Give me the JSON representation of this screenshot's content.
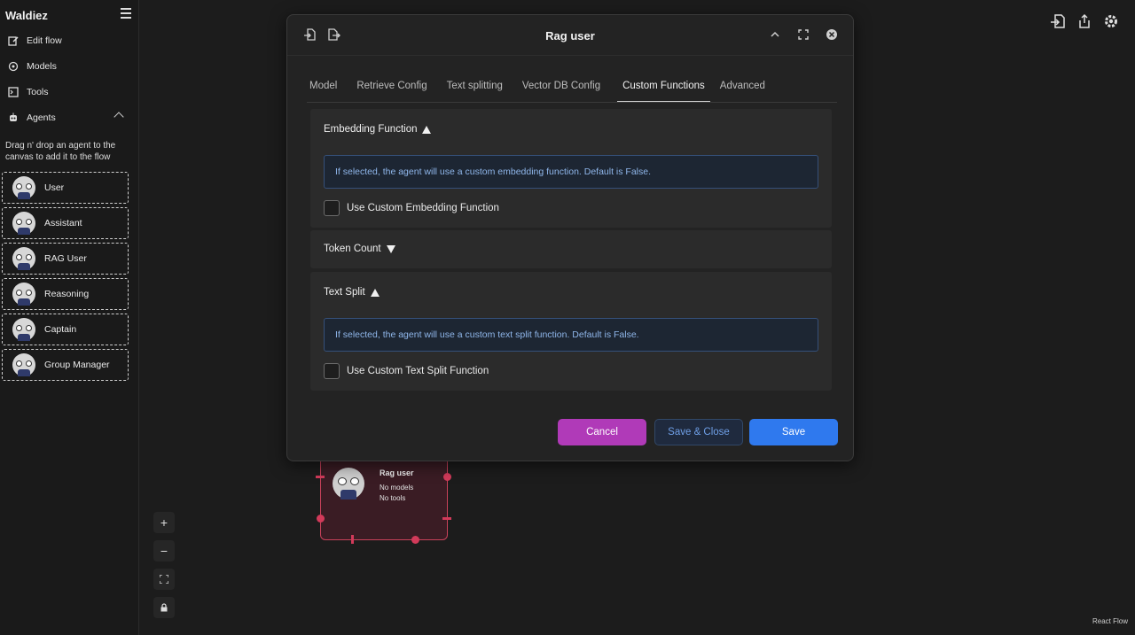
{
  "app": {
    "title": "Waldiez"
  },
  "sidebar": {
    "nav": [
      {
        "label": "Edit flow",
        "icon": "edit-icon"
      },
      {
        "label": "Models",
        "icon": "models-icon"
      },
      {
        "label": "Tools",
        "icon": "tools-icon"
      },
      {
        "label": "Agents",
        "icon": "robot-icon"
      }
    ],
    "hint": "Drag n' drop an agent to the canvas to add it to the flow",
    "agents": [
      "User",
      "Assistant",
      "RAG User",
      "Reasoning",
      "Captain",
      "Group Manager"
    ]
  },
  "canvas": {
    "node": {
      "title": "Rag user",
      "models": "No models",
      "tools": "No tools"
    },
    "controls": [
      "+",
      "−",
      "⛶",
      "🔒"
    ],
    "attribution": "React Flow"
  },
  "modal": {
    "title": "Rag user",
    "tabs": [
      "Model",
      "Retrieve Config",
      "Text splitting",
      "Vector DB Config",
      "Custom Functions",
      "Advanced"
    ],
    "active_tab": "Custom Functions",
    "sections": {
      "embedding": {
        "title": "Embedding Function",
        "info": "If selected, the agent will use a custom embedding function. Default is False.",
        "checkbox_label": "Use Custom Embedding Function"
      },
      "token_count": {
        "title": "Token Count"
      },
      "text_split": {
        "title": "Text Split",
        "info": "If selected, the agent will use a custom text split function. Default is False.",
        "checkbox_label": "Use Custom Text Split Function"
      }
    },
    "buttons": {
      "cancel": "Cancel",
      "save_close": "Save & Close",
      "save": "Save"
    }
  },
  "colors": {
    "cancel": "#b03ab8",
    "save": "#2f79ee",
    "node_border": "#c8415a",
    "info_text": "#8fb6ea"
  }
}
